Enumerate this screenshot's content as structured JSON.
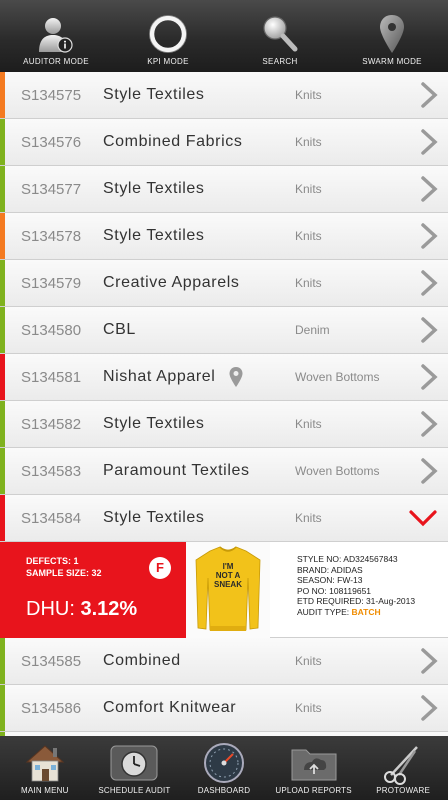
{
  "top_nav": [
    {
      "label": "AUDITOR MODE",
      "icon": "auditor-icon"
    },
    {
      "label": "KPI MODE",
      "icon": "kpi-ring-icon"
    },
    {
      "label": "SEARCH",
      "icon": "search-icon"
    },
    {
      "label": "SWARM MODE",
      "icon": "map-pin-icon"
    }
  ],
  "colors": {
    "green": "#7fb21e",
    "orange": "#f47a20",
    "red": "#e8141c",
    "accent": "#f08c00"
  },
  "audits": [
    {
      "code": "S134575",
      "name": "Style Textiles",
      "category": "Knits",
      "status": "orange"
    },
    {
      "code": "S134576",
      "name": "Combined Fabrics",
      "category": "Knits",
      "status": "green"
    },
    {
      "code": "S134577",
      "name": "Style Textiles",
      "category": "Knits",
      "status": "green"
    },
    {
      "code": "S134578",
      "name": "Style Textiles",
      "category": "Knits",
      "status": "orange"
    },
    {
      "code": "S134579",
      "name": "Creative Apparels",
      "category": "Knits",
      "status": "green"
    },
    {
      "code": "S134580",
      "name": "CBL",
      "category": "Denim",
      "status": "green"
    },
    {
      "code": "S134581",
      "name": "Nishat Apparel",
      "category": "Woven Bottoms",
      "status": "red",
      "has_location": true
    },
    {
      "code": "S134582",
      "name": "Style Textiles",
      "category": "Knits",
      "status": "green"
    },
    {
      "code": "S134583",
      "name": "Paramount Textiles",
      "category": "Woven Bottoms",
      "status": "green"
    },
    {
      "code": "S134584",
      "name": "Style Textiles",
      "category": "Knits",
      "status": "red",
      "expanded": true
    },
    {
      "code": "S134585",
      "name": "Combined",
      "category": "Knits",
      "status": "green"
    },
    {
      "code": "S134586",
      "name": "Comfort Knitwear",
      "category": "Knits",
      "status": "green"
    }
  ],
  "expanded_detail": {
    "defects": "DEFECTS: 1",
    "sample_size": "SAMPLE SIZE: 32",
    "dhu_label": "DHU: ",
    "dhu_value": "3.12%",
    "grade": "F",
    "product_image": "yellow sweatshirt",
    "shirt_print_line1": "I'M",
    "shirt_print_line2": "NOT A",
    "shirt_print_line3": "SNEAK",
    "style_no": "STYLE NO: AD324567843",
    "brand": "BRAND: ADIDAS",
    "season": "SEASON: FW-13",
    "po_no": "PO NO: 108119651",
    "etd": "ETD REQUIRED: 31-Aug-2013",
    "audit_type_label": "AUDIT TYPE: ",
    "audit_type_value": "BATCH"
  },
  "bottom_nav": [
    {
      "label": "MAIN MENU",
      "icon": "house-icon"
    },
    {
      "label": "SCHEDULE AUDIT",
      "icon": "clock-icon"
    },
    {
      "label": "DASHBOARD",
      "icon": "gauge-icon"
    },
    {
      "label": "UPLOAD REPORTS",
      "icon": "upload-folder-icon"
    },
    {
      "label": "PROTOWARE",
      "icon": "scissors-icon"
    }
  ]
}
